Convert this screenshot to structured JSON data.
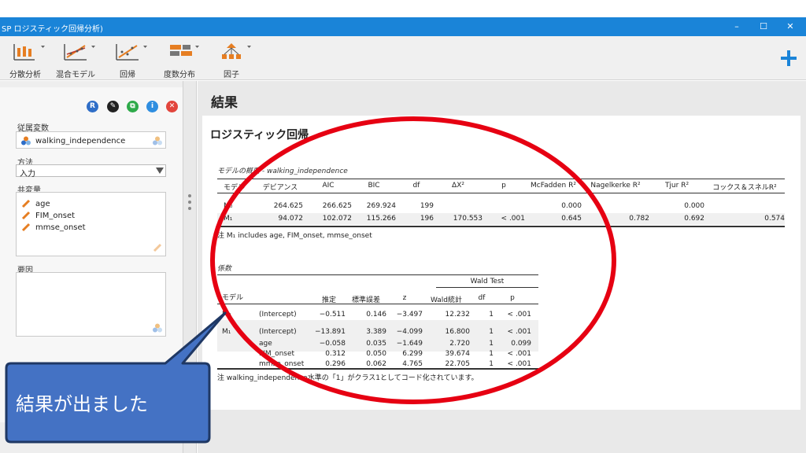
{
  "window": {
    "title": "SP ロジスティック回帰分析)"
  },
  "toolbar": {
    "items": [
      {
        "label": "分散分析"
      },
      {
        "label": "混合モデル"
      },
      {
        "label": "回帰"
      },
      {
        "label": "度数分布"
      },
      {
        "label": "因子"
      }
    ]
  },
  "left_panel": {
    "header_buttons": [
      "R",
      "✎",
      "⧉",
      "i",
      "✕"
    ],
    "dependent_label": "従属変数",
    "dependent_value": "walking_independence",
    "method_label": "方法",
    "method_value": "入力",
    "covariates_label": "共変量",
    "covariates": [
      "age",
      "FIM_onset",
      "mmse_onset"
    ],
    "factors_label": "要因"
  },
  "results": {
    "header": "結果",
    "section_title": "ロジスティック回帰",
    "model_fit": {
      "caption": "モデルの概要 - walking_independence",
      "columns": [
        "モデル",
        "デビアンス",
        "AIC",
        "BIC",
        "df",
        "ΔΧ²",
        "p",
        "McFadden R²",
        "Nagelkerke R²",
        "Tjur R²",
        "コックス＆スネルR²"
      ],
      "rows": [
        [
          "M₀",
          "264.625",
          "266.625",
          "269.924",
          "199",
          "",
          "",
          "0.000",
          "",
          "0.000",
          ""
        ],
        [
          "M₁",
          "94.072",
          "102.072",
          "115.266",
          "196",
          "170.553",
          "< .001",
          "0.645",
          "0.782",
          "0.692",
          "0.574"
        ]
      ],
      "note": "注 M₁ includes age, FIM_onset, mmse_onset"
    },
    "coefficients": {
      "caption": "係数",
      "group_header": "Wald Test",
      "columns": [
        "モデル",
        "",
        "推定",
        "標準誤差",
        "z",
        "Wald統計",
        "df",
        "p"
      ],
      "rows": [
        [
          "M₀",
          "(Intercept)",
          "−0.511",
          "0.146",
          "−3.497",
          "12.232",
          "1",
          "< .001"
        ],
        [
          "M₁",
          "(Intercept)",
          "−13.891",
          "3.389",
          "−4.099",
          "16.800",
          "1",
          "< .001"
        ],
        [
          "",
          "age",
          "−0.058",
          "0.035",
          "−1.649",
          "2.720",
          "1",
          "0.099"
        ],
        [
          "",
          "FIM_onset",
          "0.312",
          "0.050",
          "6.299",
          "39.674",
          "1",
          "< .001"
        ],
        [
          "",
          "mmse_onset",
          "0.296",
          "0.062",
          "4.765",
          "22.705",
          "1",
          "< .001"
        ]
      ],
      "note": "注 walking_independence水準の「1」がクラス1としてコード化されています。"
    }
  },
  "callout": {
    "text": "結果が出ました"
  },
  "colors": {
    "titlebar": "#1a84d8",
    "ellipse": "#e60012",
    "callout": "#4472c4"
  }
}
